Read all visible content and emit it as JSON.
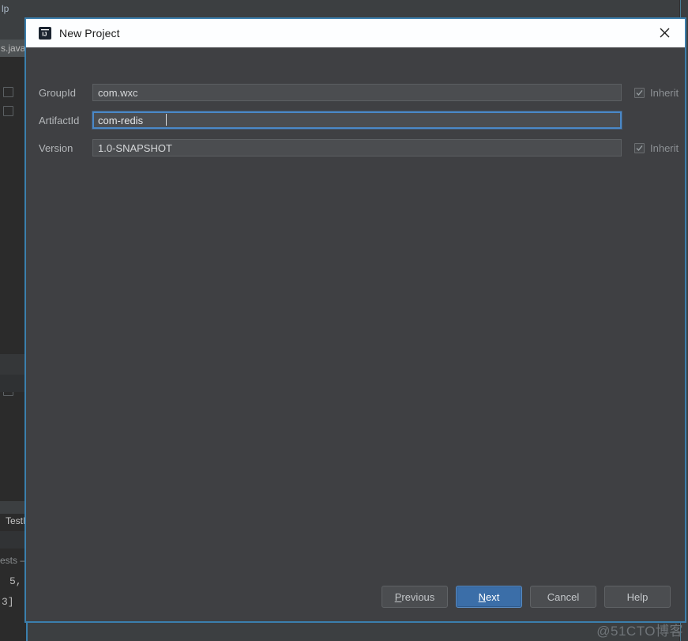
{
  "ide": {
    "menu_fragment": "lp",
    "tab_fragment": "s.java",
    "fragments": {
      "test_label": "TestI",
      "tests_label": "ests –",
      "num_line_1": "5,",
      "num_line_2": "3]"
    }
  },
  "dialog": {
    "title": "New Project",
    "icon": "intellij-idea-icon",
    "close_icon": "close-icon",
    "accent_color": "#3b7fad",
    "body_color": "#3f4043",
    "titlebar_color": "#fdfeff",
    "fields": [
      {
        "label": "GroupId",
        "value": "com.wxc",
        "focused": false,
        "inherit": true,
        "inherit_label": "Inherit"
      },
      {
        "label": "ArtifactId",
        "value": "com-redis",
        "focused": true,
        "inherit": false,
        "inherit_label": ""
      },
      {
        "label": "Version",
        "value": "1.0-SNAPSHOT",
        "focused": false,
        "inherit": true,
        "inherit_label": "Inherit"
      }
    ],
    "buttons": {
      "previous": {
        "pre": "",
        "mnemonic": "P",
        "post": "revious",
        "default": false
      },
      "next": {
        "pre": "",
        "mnemonic": "N",
        "post": "ext",
        "default": true
      },
      "cancel": {
        "pre": "",
        "mnemonic": "",
        "post": "Cancel",
        "default": false
      },
      "help": {
        "pre": "",
        "mnemonic": "",
        "post": "Help",
        "default": false
      }
    }
  },
  "watermark": {
    "text": "@51CTO博客"
  }
}
